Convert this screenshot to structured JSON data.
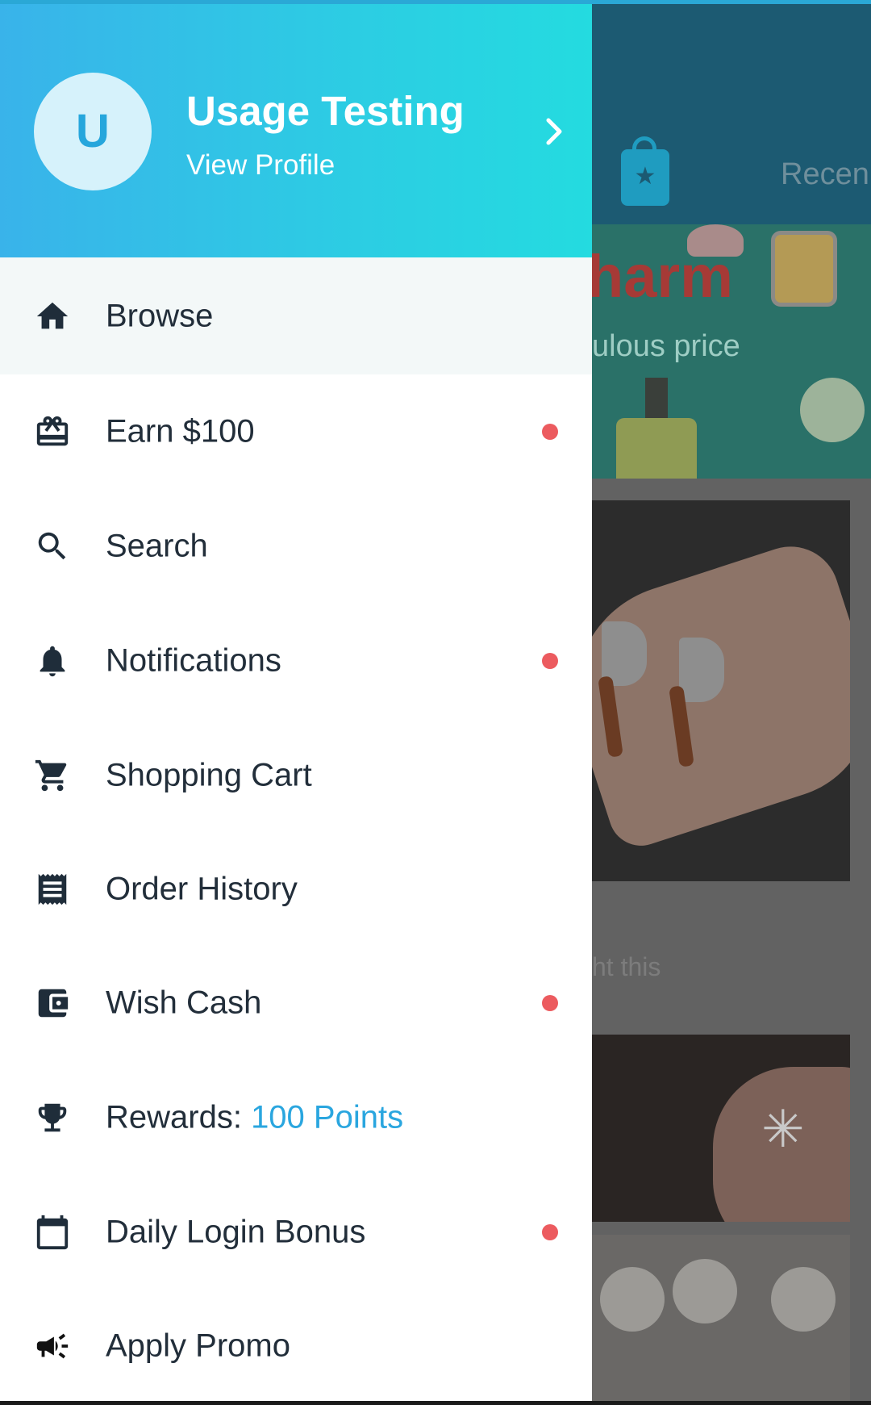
{
  "background": {
    "header_tab_label": "Recen",
    "banner_title": "harm",
    "banner_subtitle": "ulous price",
    "product_caption": "ht this"
  },
  "drawer": {
    "header": {
      "avatar_initial": "U",
      "user_name": "Usage Testing",
      "view_profile": "View Profile"
    },
    "items": [
      {
        "label": "Browse",
        "icon": "home-icon",
        "active": true,
        "dot": false
      },
      {
        "label": "Earn $100",
        "icon": "gift-icon",
        "active": false,
        "dot": true
      },
      {
        "label": "Search",
        "icon": "search-icon",
        "active": false,
        "dot": false
      },
      {
        "label": "Notifications",
        "icon": "bell-icon",
        "active": false,
        "dot": true
      },
      {
        "label": "Shopping Cart",
        "icon": "cart-icon",
        "active": false,
        "dot": false
      },
      {
        "label": "Order History",
        "icon": "receipt-icon",
        "active": false,
        "dot": false
      },
      {
        "label": "Wish Cash",
        "icon": "wallet-icon",
        "active": false,
        "dot": true
      },
      {
        "label": "Rewards: ",
        "accent": "100 Points",
        "icon": "trophy-icon",
        "active": false,
        "dot": false
      },
      {
        "label": "Daily Login Bonus",
        "icon": "calendar-icon",
        "active": false,
        "dot": true
      },
      {
        "label": "Apply Promo",
        "icon": "megaphone-icon",
        "active": false,
        "dot": false
      }
    ]
  },
  "colors": {
    "header_gradient_start": "#39b3ea",
    "header_gradient_end": "#24dbe0",
    "accent": "#2aa6df",
    "notification_dot": "#ec5b5f",
    "text": "#222e3a"
  }
}
